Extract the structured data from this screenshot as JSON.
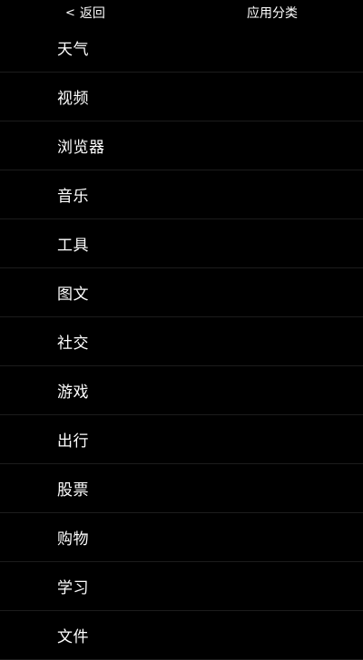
{
  "header": {
    "back_chevron": "<",
    "back_label": "返回",
    "title": "应用分类"
  },
  "categories": [
    {
      "label": "天气"
    },
    {
      "label": "视频"
    },
    {
      "label": "浏览器"
    },
    {
      "label": "音乐"
    },
    {
      "label": "工具"
    },
    {
      "label": "图文"
    },
    {
      "label": "社交"
    },
    {
      "label": "游戏"
    },
    {
      "label": "出行"
    },
    {
      "label": "股票"
    },
    {
      "label": "购物"
    },
    {
      "label": "学习"
    },
    {
      "label": "文件"
    }
  ],
  "colors": {
    "background": "#000000",
    "text": "#ffffff",
    "divider": "#1c1c1c"
  }
}
